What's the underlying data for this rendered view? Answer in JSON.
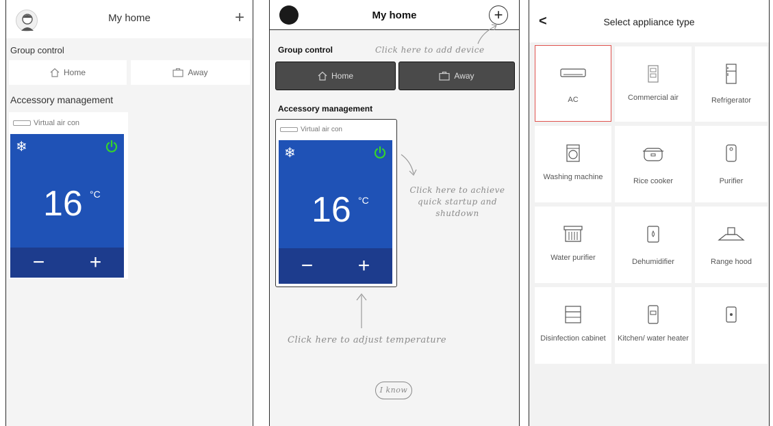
{
  "screen1": {
    "title": "My home",
    "group_control": "Group control",
    "home_label": "Home",
    "away_label": "Away",
    "accessory_management": "Accessory management",
    "device_name": "Virtual air con",
    "temperature": "16",
    "unit": "°C",
    "minus": "−",
    "plus": "+"
  },
  "screen2": {
    "title": "My home",
    "group_control": "Group control",
    "home_label": "Home",
    "away_label": "Away",
    "accessory_management": "Accessory management",
    "device_name": "Virtual air con",
    "temperature": "16",
    "unit": "°C",
    "minus": "−",
    "plus": "+",
    "hint_add_device": "Click here to add device",
    "hint_startup_line1": "Click here to achieve",
    "hint_startup_line2": "quick startup and",
    "hint_startup_line3": "shutdown",
    "hint_temperature": "Click here to adjust temperature",
    "i_know": "I know"
  },
  "screen3": {
    "back": "<",
    "title": "Select appliance type",
    "tiles": [
      {
        "label": "AC",
        "icon": "ac-icon"
      },
      {
        "label": "Commercial air",
        "icon": "commercial-air-icon"
      },
      {
        "label": "Refrigerator",
        "icon": "refrigerator-icon"
      },
      {
        "label": "Washing machine",
        "icon": "washing-machine-icon"
      },
      {
        "label": "Rice cooker",
        "icon": "rice-cooker-icon"
      },
      {
        "label": "Purifier",
        "icon": "purifier-icon"
      },
      {
        "label": "Water purifier",
        "icon": "water-purifier-icon"
      },
      {
        "label": "Dehumidifier",
        "icon": "dehumidifier-icon"
      },
      {
        "label": "Range hood",
        "icon": "range-hood-icon"
      },
      {
        "label": "Disinfection cabinet",
        "icon": "disinfection-cabinet-icon"
      },
      {
        "label": "Kitchen/ water heater",
        "icon": "water-heater-icon"
      },
      {
        "label": "",
        "icon": "small-appliance-icon"
      }
    ]
  },
  "colors": {
    "ac_panel": "#1f52b6",
    "ac_controls": "#1d3c8d",
    "power_green": "#35d42b",
    "selected_border": "#e0524d",
    "overlay_dark": "#444444"
  }
}
